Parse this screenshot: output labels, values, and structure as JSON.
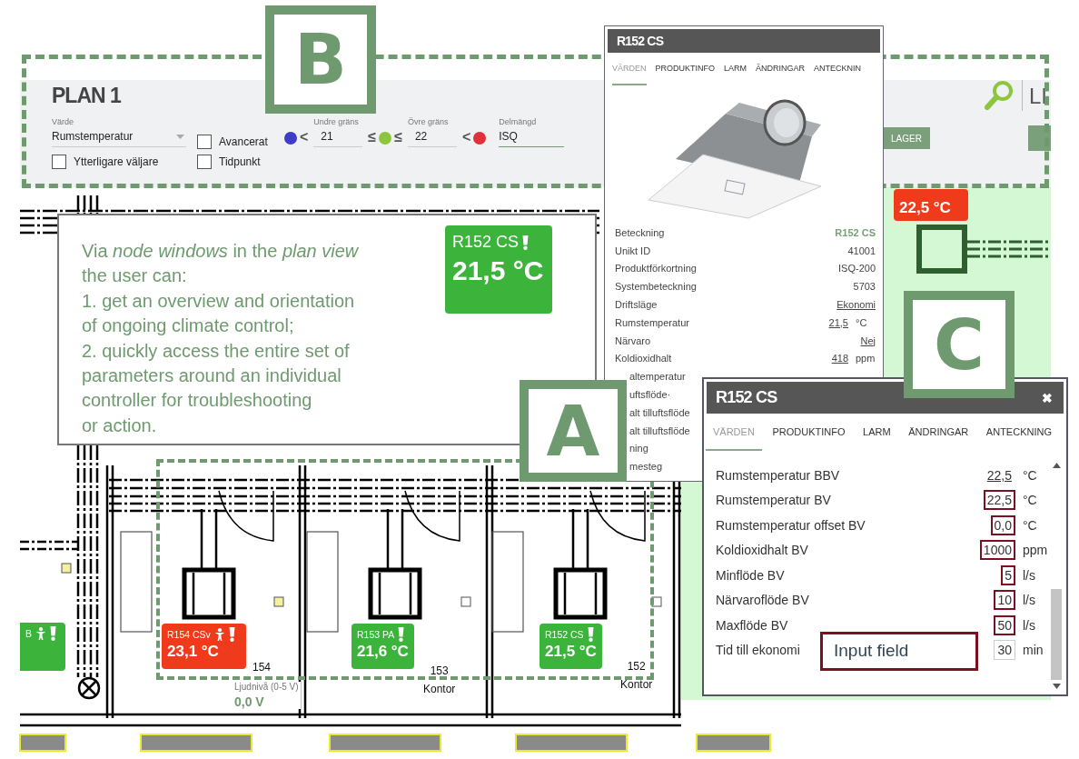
{
  "header": {
    "title": "PLAN 1",
    "value_field": {
      "label": "Värde",
      "value": "Rumstemperatur"
    },
    "checkboxes": [
      {
        "label": "Avancerat",
        "checked": false
      },
      {
        "label": "Ytterligare väljare",
        "checked": false
      },
      {
        "label": "Tidpunkt",
        "checked": false
      }
    ],
    "range": [
      {
        "kind": "dot",
        "color": "#3d3dc8"
      },
      {
        "kind": "symbol",
        "text": "<"
      },
      {
        "kind": "field",
        "label": "Undre gräns",
        "value": "21"
      },
      {
        "kind": "symbol",
        "text": "≤"
      },
      {
        "kind": "dot",
        "color": "#8cc63f"
      },
      {
        "kind": "symbol",
        "text": "≤"
      },
      {
        "kind": "field",
        "label": "Övre gräns",
        "value": "22"
      },
      {
        "kind": "symbol",
        "text": "<"
      },
      {
        "kind": "dot",
        "color": "#e0303a"
      }
    ],
    "subset_field": {
      "label": "Delmängd",
      "value": "ISQ"
    },
    "button": {
      "label": "LAGER"
    },
    "cut_text": "LI"
  },
  "callout": {
    "text": "Via *node windows* in the *plan view*\nthe user can:\n1. get an overview and orientation\nof ongoing climate control;\n2. quickly access the entire set of\nparameters around an individual\ncontroller for troubleshooting\nor action.",
    "badge": {
      "label": "R152 CS",
      "temp": "21,5 °C",
      "color": "#3cb43c",
      "presence": false,
      "warning": true
    }
  },
  "annotations": [
    {
      "letter": "B"
    },
    {
      "letter": "A"
    },
    {
      "letter": "C"
    }
  ],
  "input_note": {
    "text": "Input field"
  },
  "plan_badges": [
    {
      "label": "B",
      "color": "#3cb43c",
      "presence": true,
      "warning": true
    },
    {
      "label": "R154 CSv",
      "temp": "23,1 °C",
      "color": "#f03a1c",
      "presence": true,
      "warning": true
    },
    {
      "label": "R153 PA",
      "temp": "21,6 °C",
      "color": "#3cb43c",
      "presence": false,
      "warning": true
    },
    {
      "label": "R152 CS",
      "temp": "21,5 °C",
      "color": "#3cb43c",
      "presence": false,
      "warning": true
    },
    {
      "temp": "22,5 °C",
      "color": "#f03a1c",
      "presence": false,
      "warning": false
    }
  ],
  "rooms": [
    {
      "number": "154"
    },
    {
      "number": "153",
      "name": "Kontor"
    },
    {
      "number": "152",
      "name": "Kontor"
    }
  ],
  "sensor": {
    "label": "Ljudnivå (0-5 V)",
    "value": "0,0 V"
  },
  "node_window": {
    "title": "R152 CS",
    "tabs": [
      {
        "label": "VÄRDEN",
        "selected": true
      },
      {
        "label": "PRODUKTINFO",
        "selected": false
      },
      {
        "label": "LARM",
        "selected": false
      },
      {
        "label": "ÄNDRINGAR",
        "selected": false
      },
      {
        "label": "ANTECKNIN",
        "selected": false
      }
    ],
    "rows": [
      {
        "label": "Beteckning",
        "value": "R152 CS",
        "kind": "name"
      },
      {
        "label": "Unikt ID",
        "value": "41001",
        "kind": "text"
      },
      {
        "label": "Produktförkortning",
        "value": "ISQ-200",
        "kind": "text"
      },
      {
        "label": "Systembeteckning",
        "value": "5703",
        "kind": "text"
      },
      {
        "label": "Driftsläge",
        "value": "Ekonomi",
        "kind": "link"
      },
      {
        "label": "Rumstemperatur",
        "value": "21,5",
        "unit": "°C",
        "kind": "link"
      },
      {
        "label": "Närvaro",
        "value": "Nej",
        "kind": "link"
      },
      {
        "label": "Koldioxidhalt",
        "value": "418",
        "unit": "ppm",
        "kind": "link"
      },
      {
        "label": "altemperatur",
        "kind": "partial"
      },
      {
        "label": "uftsflöde·",
        "kind": "partial"
      },
      {
        "label": "alt tilluftsflöde",
        "kind": "partial"
      },
      {
        "label": "alt tilluftsflöde",
        "kind": "partial"
      },
      {
        "label": "ning",
        "kind": "partial"
      },
      {
        "label": "mesteg",
        "kind": "partial"
      }
    ]
  },
  "settings_window": {
    "title": "R152 CS",
    "close": "✖",
    "tabs": [
      {
        "label": "VÄRDEN",
        "selected": true
      },
      {
        "label": "PRODUKTINFO",
        "selected": false
      },
      {
        "label": "LARM",
        "selected": false
      },
      {
        "label": "ÄNDRINGAR",
        "selected": false
      },
      {
        "label": "ANTECKNING",
        "selected": false
      }
    ],
    "rows": [
      {
        "label": "Rumstemperatur BBV",
        "value": "22,5",
        "unit": "°C",
        "kind": "link",
        "highlighted": false
      },
      {
        "label": "Rumstemperatur BV",
        "value": "22,5",
        "unit": "°C",
        "kind": "value",
        "highlighted": true
      },
      {
        "label": "Rumstemperatur offset BV",
        "value": "0,0",
        "unit": "°C",
        "kind": "value",
        "highlighted": true
      },
      {
        "label": "Koldioxidhalt BV",
        "value": "1000",
        "unit": "ppm",
        "kind": "value",
        "highlighted": true
      },
      {
        "label": "Minflöde BV",
        "value": "5",
        "unit": "l/s",
        "kind": "value",
        "highlighted": true
      },
      {
        "label": "Närvaroflöde BV",
        "value": "10",
        "unit": "l/s",
        "kind": "value",
        "highlighted": true
      },
      {
        "label": "Maxflöde BV",
        "value": "50",
        "unit": "l/s",
        "kind": "value",
        "highlighted": true
      },
      {
        "label": "Tid till ekonomi",
        "value": "30",
        "unit": "min",
        "kind": "field",
        "highlighted": false
      }
    ]
  }
}
